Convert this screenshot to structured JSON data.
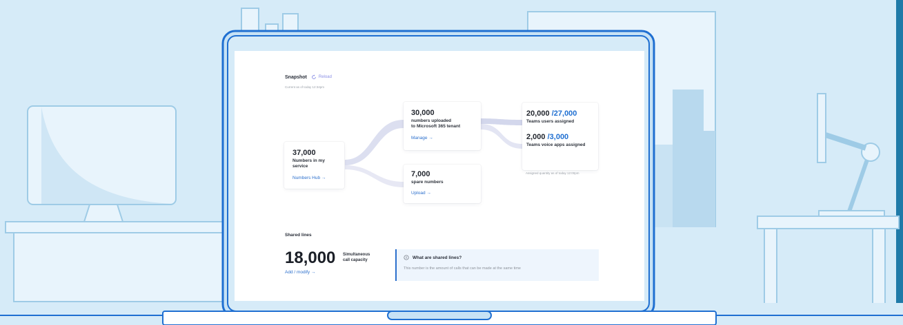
{
  "snapshot": {
    "title": "Snapshot",
    "reload_label": "Reload",
    "current_as_of": "Current as of today 12:34pm"
  },
  "numbers_total": {
    "value": "37,000",
    "label_line1": "Numbers in my",
    "label_line2": "service",
    "link": "Numbers Hub →"
  },
  "numbers_uploaded": {
    "value": "30,000",
    "label_line1": "numbers uploaded",
    "label_line2": "to Microsoft 365 tenant",
    "link": "Manage →"
  },
  "numbers_spare": {
    "value": "7,000",
    "label": "spare numbers",
    "link": "Upload →"
  },
  "teams_users": {
    "assigned": "20,000",
    "total": "/27,000",
    "label": "Teams users assigned"
  },
  "teams_voice": {
    "assigned": "2,000",
    "total": "/3,000",
    "label": "Teams voice apps assigned"
  },
  "assigned_note": "Assigned quantity as of today 12:00pm",
  "shared_lines": {
    "title": "Shared lines",
    "value": "18,000",
    "label_line1": "Simultaneous",
    "label_line2": "call capacity",
    "link": "Add / modify →",
    "info_title": "What are shared lines?",
    "info_text": "This number is the amount of calls that can be made at the same time"
  },
  "colors": {
    "accent": "#2b6fcc",
    "background": "#d6ebf8",
    "outline": "#1f6fd1"
  }
}
